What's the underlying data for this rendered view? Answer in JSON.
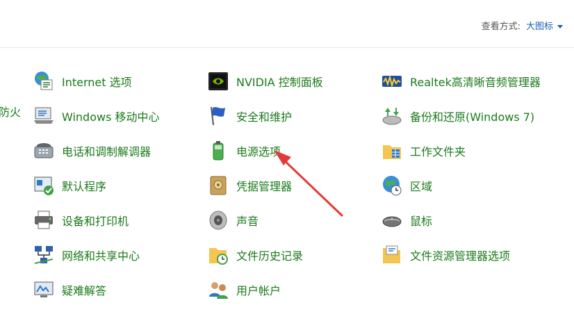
{
  "header": {
    "view_by_label": "查看方式:",
    "view_by_value": "大图标"
  },
  "clipped_text": "防火",
  "items": [
    {
      "label": "Internet 选项",
      "icon": "internet-options-icon"
    },
    {
      "label": "NVIDIA 控制面板",
      "icon": "nvidia-icon"
    },
    {
      "label": "Realtek高清晰音频管理器",
      "icon": "realtek-audio-icon"
    },
    {
      "label": "Windows 移动中心",
      "icon": "mobility-center-icon"
    },
    {
      "label": "安全和维护",
      "icon": "flag-icon"
    },
    {
      "label": "备份和还原(Windows 7)",
      "icon": "backup-icon"
    },
    {
      "label": "电话和调制解调器",
      "icon": "phone-modem-icon"
    },
    {
      "label": "电源选项",
      "icon": "battery-icon"
    },
    {
      "label": "工作文件夹",
      "icon": "work-folders-icon"
    },
    {
      "label": "默认程序",
      "icon": "default-programs-icon"
    },
    {
      "label": "凭据管理器",
      "icon": "credential-manager-icon"
    },
    {
      "label": "区域",
      "icon": "globe-clock-icon"
    },
    {
      "label": "设备和打印机",
      "icon": "printer-icon"
    },
    {
      "label": "声音",
      "icon": "speaker-icon"
    },
    {
      "label": "鼠标",
      "icon": "mouse-icon"
    },
    {
      "label": "网络和共享中心",
      "icon": "network-icon"
    },
    {
      "label": "文件历史记录",
      "icon": "file-history-icon"
    },
    {
      "label": "文件资源管理器选项",
      "icon": "folder-options-icon"
    },
    {
      "label": "疑难解答",
      "icon": "troubleshoot-icon"
    },
    {
      "label": "用户帐户",
      "icon": "user-accounts-icon"
    }
  ],
  "annotation_color": "#e53935"
}
